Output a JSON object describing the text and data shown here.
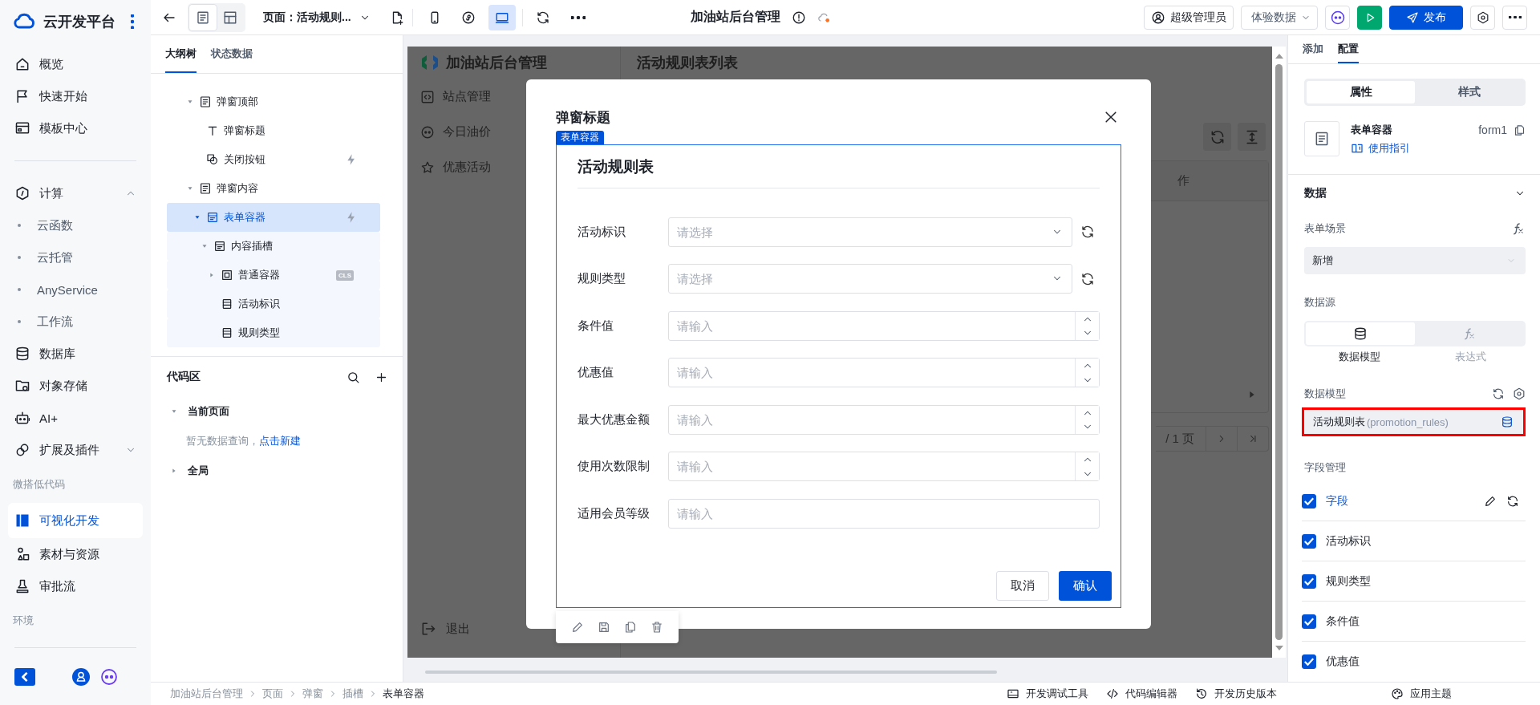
{
  "sidebar": {
    "brand": "云开发平台",
    "items": [
      {
        "kind": "link",
        "label": "概览",
        "selected": false
      },
      {
        "kind": "link",
        "label": "快速开始",
        "selected": false
      },
      {
        "kind": "link",
        "label": "模板中心",
        "selected": false
      },
      {
        "kind": "group",
        "label": "计算",
        "selected": false,
        "expanded": true,
        "children": [
          {
            "label": "云函数",
            "selected": false
          },
          {
            "label": "云托管",
            "selected": false
          },
          {
            "label": "AnyService",
            "selected": false
          },
          {
            "label": "工作流",
            "selected": false
          }
        ]
      },
      {
        "kind": "link",
        "label": "数据库",
        "selected": false
      },
      {
        "kind": "link",
        "label": "对象存储",
        "selected": false
      },
      {
        "kind": "link",
        "label": "AI+",
        "selected": false
      },
      {
        "kind": "group",
        "label": "扩展及插件",
        "selected": false,
        "expanded": false
      },
      {
        "kind": "section",
        "label": "微搭低代码"
      },
      {
        "kind": "link",
        "label": "可视化开发",
        "selected": true
      },
      {
        "kind": "link",
        "label": "素材与资源",
        "selected": false
      },
      {
        "kind": "link",
        "label": "审批流",
        "selected": false
      },
      {
        "kind": "section",
        "label": "环境"
      }
    ]
  },
  "topbar": {
    "views": [
      {
        "kind": "page",
        "selected": true
      },
      {
        "kind": "layout",
        "selected": false
      }
    ],
    "page_selector": "页面：活动规则...",
    "devices": [
      {
        "kind": "mobile",
        "selected": false
      },
      {
        "kind": "miniprogram",
        "selected": false
      },
      {
        "kind": "desktop",
        "selected": true
      }
    ],
    "title": "加油站后台管理",
    "user": "超级管理员",
    "data_mode": "体验数据",
    "publish": "发布"
  },
  "outline": {
    "tabs": [
      {
        "label": "大纲树",
        "selected": true
      },
      {
        "label": "状态数据",
        "selected": false
      }
    ],
    "tree": [
      {
        "label": "弹窗顶部",
        "kind": "container",
        "selected": false,
        "expanded": true,
        "children": [
          {
            "label": "弹窗标题",
            "kind": "text",
            "selected": false
          },
          {
            "label": "关闭按钮",
            "kind": "button",
            "selected": false,
            "event": true
          }
        ]
      },
      {
        "label": "弹窗内容",
        "kind": "container",
        "selected": false,
        "expanded": true,
        "children": [
          {
            "label": "表单容器",
            "kind": "form",
            "selected": true,
            "event": true,
            "expanded": true,
            "children": [
              {
                "label": "内容插槽",
                "kind": "slot",
                "selected": false,
                "expanded": true,
                "children": [
                  {
                    "label": "普通容器",
                    "kind": "box",
                    "selected": false,
                    "expanded": false,
                    "badge": "CLS"
                  },
                  {
                    "label": "活动标识",
                    "kind": "field",
                    "selected": false
                  },
                  {
                    "label": "规则类型",
                    "kind": "field",
                    "selected": false
                  }
                ]
              }
            ]
          }
        ]
      }
    ]
  },
  "code_area": {
    "title": "代码区",
    "groups": [
      {
        "label": "当前页面",
        "expanded": true,
        "empty_text": "暂无数据查询，",
        "link": "点击新建"
      },
      {
        "label": "全局",
        "expanded": false
      }
    ]
  },
  "preview": {
    "brand": "加油站后台管理",
    "menu": [
      "站点管理",
      "今日油价",
      "优惠活动"
    ],
    "logout": "退出",
    "page_title": "活动规则表列表",
    "column_header": "作",
    "pagination": "/ 1 页"
  },
  "dialog": {
    "title": "弹窗标题",
    "badge": "表单容器",
    "form_title": "活动规则表",
    "fields": [
      {
        "label": "活动标识",
        "kind": "select",
        "placeholder": "请选择"
      },
      {
        "label": "规则类型",
        "kind": "select",
        "placeholder": "请选择"
      },
      {
        "label": "条件值",
        "kind": "number",
        "placeholder": "请输入"
      },
      {
        "label": "优惠值",
        "kind": "number",
        "placeholder": "请输入"
      },
      {
        "label": "最大优惠金额",
        "kind": "number",
        "placeholder": "请输入"
      },
      {
        "label": "使用次数限制",
        "kind": "number",
        "placeholder": "请输入"
      },
      {
        "label": "适用会员等级",
        "kind": "text",
        "placeholder": "请输入"
      }
    ],
    "cancel": "取消",
    "confirm": "确认"
  },
  "config": {
    "tabs": [
      {
        "label": "添加",
        "selected": false
      },
      {
        "label": "配置",
        "selected": true
      }
    ],
    "segments": [
      {
        "label": "属性",
        "selected": true
      },
      {
        "label": "样式",
        "selected": false
      }
    ],
    "component": {
      "name": "表单容器",
      "guide": "使用指引",
      "id": "form1"
    },
    "section": {
      "label": "数据",
      "expanded": true
    },
    "scene_label": "表单场景",
    "scene_value": "新增",
    "source_label": "数据源",
    "sources": [
      {
        "kind": "model",
        "label": "数据模型",
        "selected": true
      },
      {
        "kind": "expression",
        "label": "表达式",
        "selected": false
      }
    ],
    "model_label": "数据模型",
    "model": {
      "name": "活动规则表",
      "code": "(promotion_rules)",
      "highlighted": true
    },
    "fields_label": "字段管理",
    "fields": [
      {
        "kind": "header",
        "label": "字段",
        "checked": true
      },
      {
        "kind": "field",
        "label": "活动标识",
        "checked": true
      },
      {
        "kind": "field",
        "label": "规则类型",
        "checked": true
      },
      {
        "kind": "field",
        "label": "条件值",
        "checked": true
      },
      {
        "kind": "field",
        "label": "优惠值",
        "checked": true
      }
    ]
  },
  "status_bar": {
    "breadcrumb": [
      "加油站后台管理",
      "页面",
      "弹窗",
      "插槽",
      "表单容器"
    ],
    "tools": [
      "开发调试工具",
      "代码编辑器",
      "开发历史版本",
      "应用主题"
    ]
  }
}
